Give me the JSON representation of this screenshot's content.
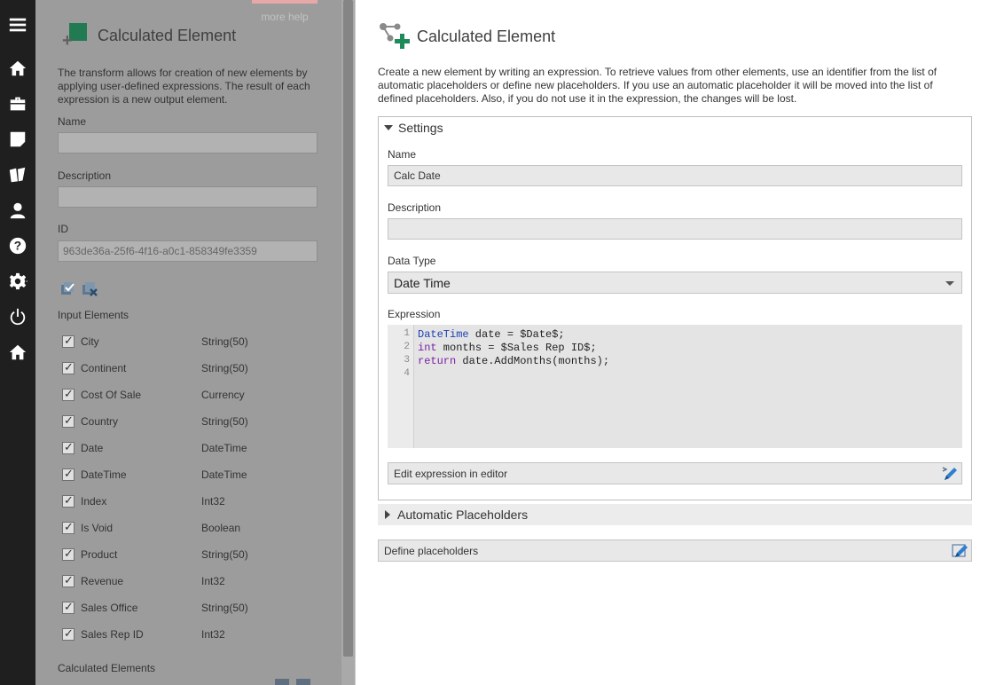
{
  "rail": {
    "items": [
      {
        "name": "menu-icon"
      },
      {
        "name": "home-icon"
      },
      {
        "name": "briefcase-icon"
      },
      {
        "name": "note-icon"
      },
      {
        "name": "book-icon"
      },
      {
        "name": "user-icon"
      },
      {
        "name": "help-icon"
      },
      {
        "name": "gear-icon"
      },
      {
        "name": "power-icon"
      },
      {
        "name": "home-icon"
      }
    ]
  },
  "panel": {
    "more_help": "more help",
    "title": "Calculated Element",
    "description": "The transform allows for creation of new elements by applying user-defined expressions. The result of each expression is a new output element.",
    "name_label": "Name",
    "name_value": "",
    "description_label": "Description",
    "description_value": "",
    "id_label": "ID",
    "id_value": "963de36a-25f6-4f16-a0c1-858349fe3359",
    "input_elements_label": "Input Elements",
    "input_elements": [
      {
        "name": "City",
        "type": "String(50)"
      },
      {
        "name": "Continent",
        "type": "String(50)"
      },
      {
        "name": "Cost Of Sale",
        "type": "Currency"
      },
      {
        "name": "Country",
        "type": "String(50)"
      },
      {
        "name": "Date",
        "type": "DateTime"
      },
      {
        "name": "DateTime",
        "type": "DateTime"
      },
      {
        "name": "Index",
        "type": "Int32"
      },
      {
        "name": "Is Void",
        "type": "Boolean"
      },
      {
        "name": "Product",
        "type": "String(50)"
      },
      {
        "name": "Revenue",
        "type": "Int32"
      },
      {
        "name": "Sales Office",
        "type": "String(50)"
      },
      {
        "name": "Sales Rep ID",
        "type": "Int32"
      }
    ],
    "calculated_elements_label": "Calculated Elements"
  },
  "dialog": {
    "title": "Calculated Element",
    "description": "Create a new element by writing an expression. To retrieve values from other elements, use an identifier from the list of automatic placeholders or define new placeholders. If you use an automatic placeholder it will be moved into the list of defined placeholders. Also, if you do not use it in the expression, the changes will be lost.",
    "settings": {
      "header": "Settings",
      "name_label": "Name",
      "name_value": "Calc Date",
      "description_label": "Description",
      "description_value": "",
      "data_type_label": "Data Type",
      "data_type_value": "Date Time",
      "expression_label": "Expression",
      "line_numbers": [
        "1",
        "2",
        "3",
        "4"
      ],
      "code": {
        "l1_type": "DateTime",
        "l1_rest": " date = $Date$;",
        "l2_type": "int",
        "l2_rest": " months = $Sales Rep ID$;",
        "l3_kw": "return",
        "l3_rest": " date.AddMonths(months);",
        "l4": ""
      },
      "edit_in_editor": "Edit expression in editor"
    },
    "automatic_placeholders": "Automatic Placeholders",
    "define_placeholders": "Define placeholders"
  }
}
